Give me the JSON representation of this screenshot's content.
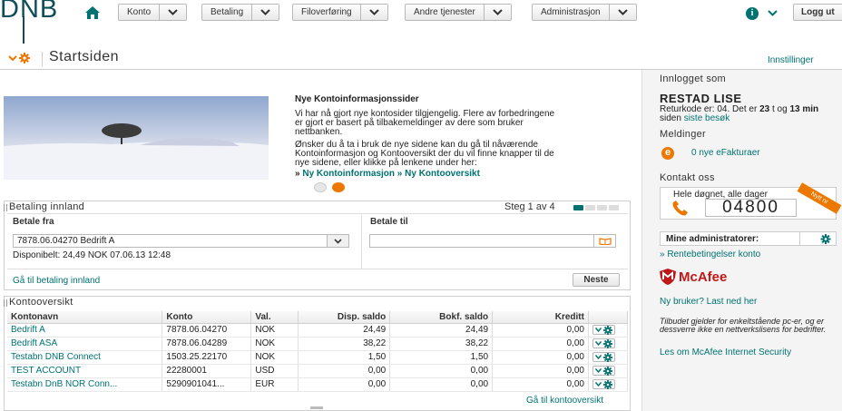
{
  "header": {
    "logo": "DNB",
    "nav": [
      {
        "label": "Konto"
      },
      {
        "label": "Betaling"
      },
      {
        "label": "Filoverføring"
      },
      {
        "label": "Andre tjenester"
      },
      {
        "label": "Administrasjon"
      }
    ],
    "info_glyph": "i",
    "logout_label": "Logg ut"
  },
  "page": {
    "title": "Startsiden",
    "settings_link": "Innstillinger"
  },
  "news": {
    "title": "Nye Kontoinformasjonssider",
    "p1": "Vi har nå gjort nye kontosider tilgjengelig. Flere av forbedringene er gjort er basert på tilbakemeldinger av dere som bruker nettbanken.",
    "p2": "Ønsker du å ta i bruk de nye sidene kan du gå til nåværende Kontoinformasjon og Kontooversikt der du vil finne knapper til de nye sidene, eller klikke på lenkene under her:",
    "link_prefix": "»",
    "link1": "Ny Kontoinformasjon",
    "link2": "» Ny Kontooversikt"
  },
  "payment": {
    "title": "Betaling innland",
    "step": "Steg 1 av 4",
    "from_label": "Betale fra",
    "to_label": "Betale til",
    "from_value": "7878.06.04270 Bedrift A",
    "available": "Disponibelt: 24,49 NOK 07.06.13 12:48",
    "to_value": "",
    "goto_link": "Gå til betaling innland",
    "next_button": "Neste"
  },
  "accounts": {
    "title": "Kontooversikt",
    "columns": [
      "Kontonavn",
      "Konto",
      "Val.",
      "Disp. saldo",
      "Bokf. saldo",
      "Kreditt",
      ""
    ],
    "rows": [
      {
        "name": "Bedrift A",
        "account": "7878.06.04270",
        "currency": "NOK",
        "disp": "24,49",
        "bokf": "24,49",
        "credit": "0,00"
      },
      {
        "name": "Bedrift ASA",
        "account": "7878.06.04289",
        "currency": "NOK",
        "disp": "38,22",
        "bokf": "38,22",
        "credit": "0,00"
      },
      {
        "name": "Testabn DNB Connect",
        "account": "1503.25.22170",
        "currency": "NOK",
        "disp": "1,50",
        "bokf": "1,50",
        "credit": "0,00"
      },
      {
        "name": "TEST ACCOUNT",
        "account": "22280001",
        "currency": "USD",
        "disp": "0,00",
        "bokf": "0,00",
        "credit": "0,00"
      },
      {
        "name": "Testabn DnB NOR Conn...",
        "account": "5290901041...",
        "currency": "EUR",
        "disp": "0,00",
        "bokf": "0,00",
        "credit": "0,00"
      }
    ],
    "goto_link": "Gå til kontooversikt"
  },
  "sidebar": {
    "logged_in_heading": "Innlogget som",
    "user_name": "RESTAD LISE",
    "return_code_prefix": "Returkode er: 04. Det er",
    "hours": "23",
    "t": "t og",
    "minutes": "13 min",
    "since": "siden",
    "last_visit_link": "siste besøk",
    "messages_heading": "Meldinger",
    "einvoice_icon_letter": "e",
    "einvoice_link": "0 nye eFakturaer",
    "contact_heading": "Kontakt oss",
    "hours_text": "Hele døgnet, alle dager",
    "phone": "04800",
    "ribbon": "Nytt nr",
    "admin_label": "Mine administratorer:",
    "interest_link": "» Rentebetingelser konto",
    "mcafee": "McAfee",
    "new_user_link": "Ny bruker? Last ned her",
    "offer_text": "Tilbudet gjelder for enkeltstående pc-er, og er dessverre ikke en nettverkslisens for bedrifter.",
    "mcafee_link": "Les om McAfee Internet Security"
  },
  "colors": {
    "accent": "#007272",
    "orange": "#ed7800",
    "logo": "#0e4c5a"
  },
  "icons": [
    "home-icon",
    "chevron-down-icon",
    "info-icon",
    "gear-icon",
    "phone-icon",
    "einvoice-icon",
    "mcafee-shield-icon",
    "book-icon"
  ]
}
